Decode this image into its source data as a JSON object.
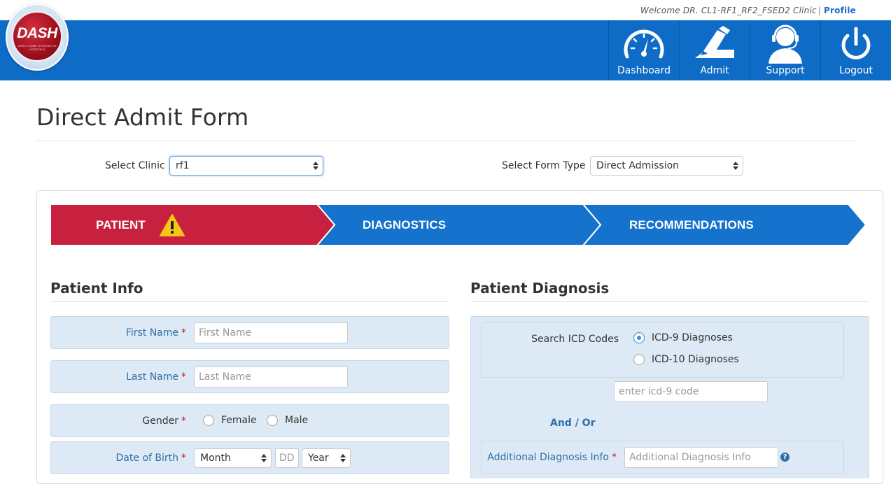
{
  "header": {
    "welcome_text": "Welcome DR. CL1-RF1_RF2_FSED2 Clinic",
    "separator": "|",
    "profile_link": "Profile",
    "logo_text": "DASH",
    "logo_subtext": "DIRECT ADMIT SYSTEM FOR HOSPITALS",
    "nav": [
      {
        "label": "Dashboard",
        "icon": "dashboard-gauge-icon"
      },
      {
        "label": "Admit",
        "icon": "admit-pen-icon"
      },
      {
        "label": "Support",
        "icon": "support-headset-icon"
      },
      {
        "label": "Logout",
        "icon": "power-icon"
      }
    ]
  },
  "page": {
    "title": "Direct Admit Form",
    "select_clinic_label": "Select Clinic",
    "select_clinic_value": "rf1",
    "select_form_type_label": "Select Form Type",
    "select_form_type_value": "Direct Admission"
  },
  "steps": [
    {
      "label": "PATIENT",
      "state": "active-warning",
      "color": "#c8203f"
    },
    {
      "label": "DIAGNOSTICS",
      "state": "inactive",
      "color": "#1572cd"
    },
    {
      "label": "RECOMMENDATIONS",
      "state": "inactive",
      "color": "#1572cd"
    }
  ],
  "patient_info": {
    "title": "Patient Info",
    "first_name_label": "First Name",
    "first_name_placeholder": "First Name",
    "last_name_label": "Last Name",
    "last_name_placeholder": "Last Name",
    "gender_label": "Gender",
    "gender_options": [
      "Female",
      "Male"
    ],
    "dob_label": "Date of Birth",
    "dob_month": "Month",
    "dob_day_placeholder": "DD",
    "dob_year": "Year",
    "required_mark": "*"
  },
  "patient_diagnosis": {
    "title": "Patient Diagnosis",
    "search_icd_label": "Search ICD Codes",
    "icd9_label": "ICD-9 Diagnoses",
    "icd10_label": "ICD-10 Diagnoses",
    "selected": "ICD-9 Diagnoses",
    "icd_code_placeholder": "enter icd-9 code",
    "and_or": "And / Or",
    "additional_label": "Additional Diagnosis Info",
    "additional_placeholder": "Additional Diagnosis Info",
    "help_glyph": "?"
  },
  "colors": {
    "header_blue": "#0f6cc6",
    "step_red": "#c8203f",
    "step_blue": "#1572cd",
    "field_bg": "#ddeaf6",
    "label_blue": "#2e6fa8"
  }
}
